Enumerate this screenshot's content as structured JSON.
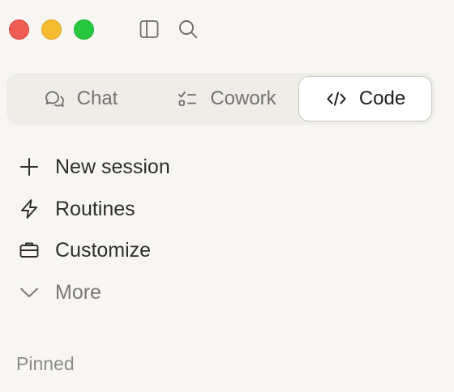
{
  "window": {
    "controls": [
      "close",
      "minimize",
      "zoom"
    ],
    "colors": {
      "close": "#ef5d54",
      "minimize": "#f5bc2f",
      "zoom": "#27c73f"
    }
  },
  "toolbar": {
    "icons": [
      "sidebar-toggle-icon",
      "search-icon"
    ]
  },
  "mode_switcher": {
    "tabs": [
      {
        "label": "Chat",
        "icon": "chat-bubbles-icon",
        "selected": false
      },
      {
        "label": "Cowork",
        "icon": "checklist-icon",
        "selected": false
      },
      {
        "label": "Code",
        "icon": "code-brackets-icon",
        "selected": true
      }
    ]
  },
  "nav": {
    "items": [
      {
        "label": "New session",
        "icon": "plus-icon"
      },
      {
        "label": "Routines",
        "icon": "lightning-icon"
      },
      {
        "label": "Customize",
        "icon": "briefcase-icon"
      },
      {
        "label": "More",
        "icon": "chevron-down-icon"
      }
    ]
  },
  "sections": {
    "pinned_label": "Pinned"
  }
}
